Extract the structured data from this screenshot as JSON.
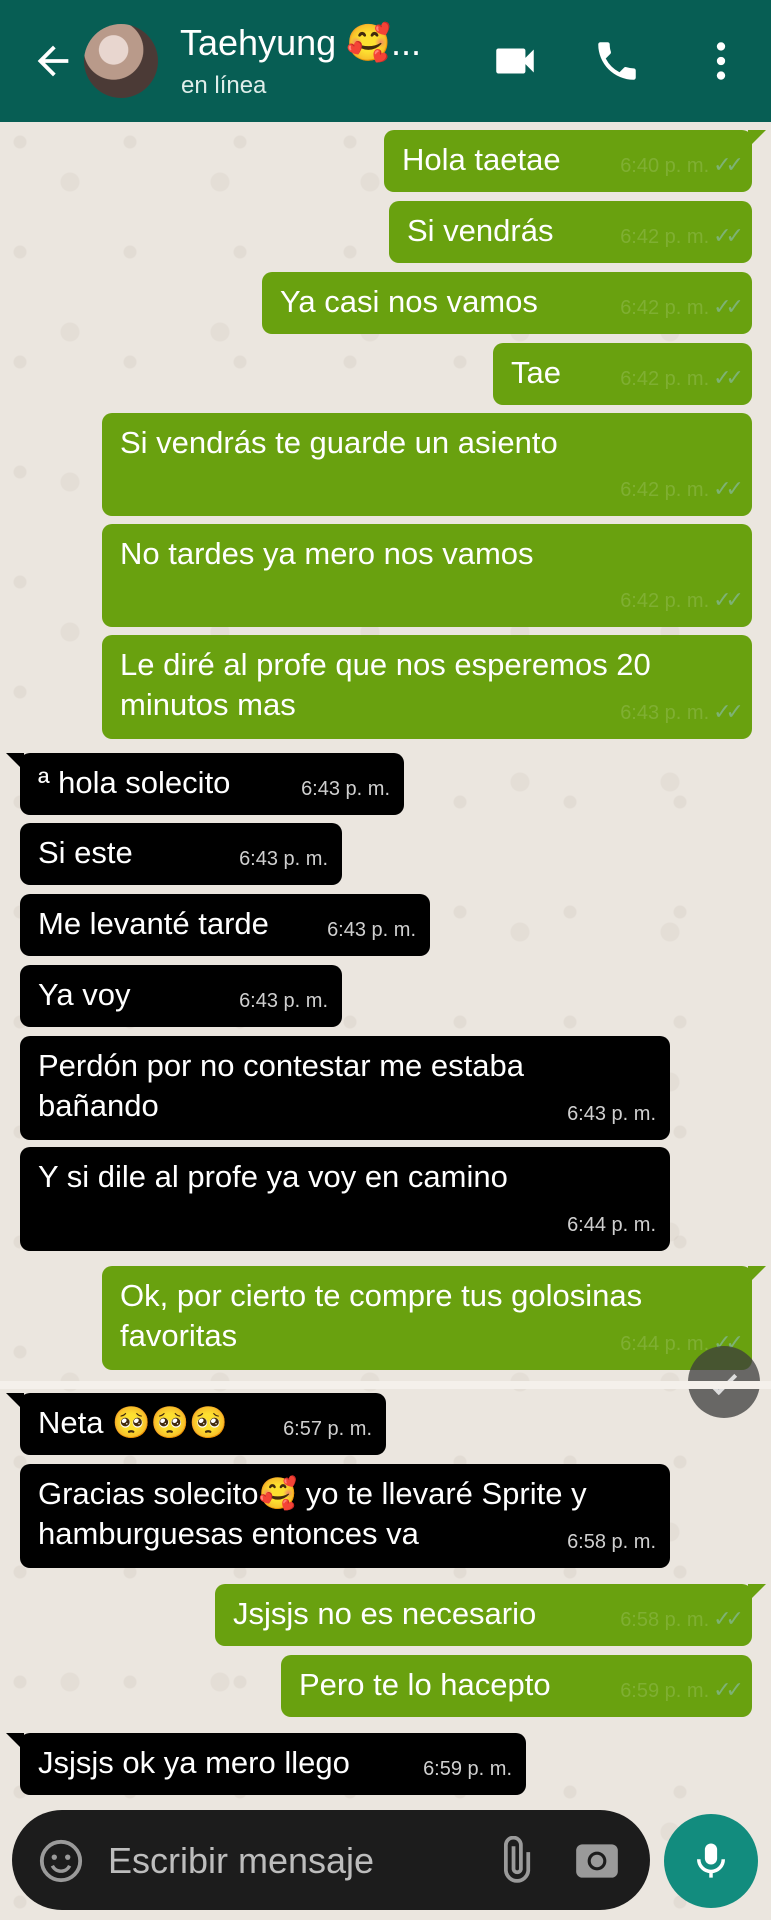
{
  "header": {
    "contact_name": "Taehyung 🥰...",
    "status": "en línea"
  },
  "messages": [
    {
      "dir": "out",
      "text": "Hola taetae",
      "time": "6:40 p. m."
    },
    {
      "dir": "out",
      "text": "Si vendrás",
      "time": "6:42 p. m."
    },
    {
      "dir": "out",
      "text": "Ya casi nos vamos",
      "time": "6:42 p. m."
    },
    {
      "dir": "out",
      "text": "Tae",
      "time": "6:42 p. m."
    },
    {
      "dir": "out",
      "text": "Si vendrás te guarde un asiento",
      "time": "6:42 p. m."
    },
    {
      "dir": "out",
      "text": "No tardes ya mero nos vamos",
      "time": "6:42 p. m."
    },
    {
      "dir": "out",
      "text": "Le diré al profe que nos esperemos 20 minutos mas",
      "time": "6:43 p. m."
    },
    {
      "dir": "in",
      "text": "ª hola solecito",
      "time": "6:43 p. m."
    },
    {
      "dir": "in",
      "text": "Si este",
      "time": "6:43 p. m."
    },
    {
      "dir": "in",
      "text": "Me levanté tarde",
      "time": "6:43 p. m."
    },
    {
      "dir": "in",
      "text": "Ya voy",
      "time": "6:43 p. m."
    },
    {
      "dir": "in",
      "text": "Perdón por no contestar me estaba bañando",
      "time": "6:43 p. m."
    },
    {
      "dir": "in",
      "text": "Y si dile al profe ya voy en camino",
      "time": "6:44 p. m."
    },
    {
      "dir": "out",
      "text": "Ok, por cierto te compre tus golosinas favoritas",
      "time": "6:44 p. m."
    },
    {
      "dir": "in",
      "text": "Neta 🥺🥺🥺",
      "time": "6:57 p. m."
    },
    {
      "dir": "in",
      "text": "Gracias solecito🥰 yo te llevaré Sprite y hamburguesas entonces va",
      "time": "6:58 p. m."
    },
    {
      "dir": "out",
      "text": "Jsjsjs no es necesario",
      "time": "6:58 p. m."
    },
    {
      "dir": "out",
      "text": "Pero te lo hacepto",
      "time": "6:59 p. m."
    },
    {
      "dir": "in",
      "text": "Jsjsjs ok ya mero llego",
      "time": "6:59 p. m."
    }
  ],
  "ticks": "✓✓",
  "composer": {
    "placeholder": "Escribir mensaje"
  },
  "colors": {
    "header": "#075e54",
    "outgoing_bubble": "#69a10f",
    "incoming_bubble": "#000000",
    "mic_button": "#128c7e"
  }
}
